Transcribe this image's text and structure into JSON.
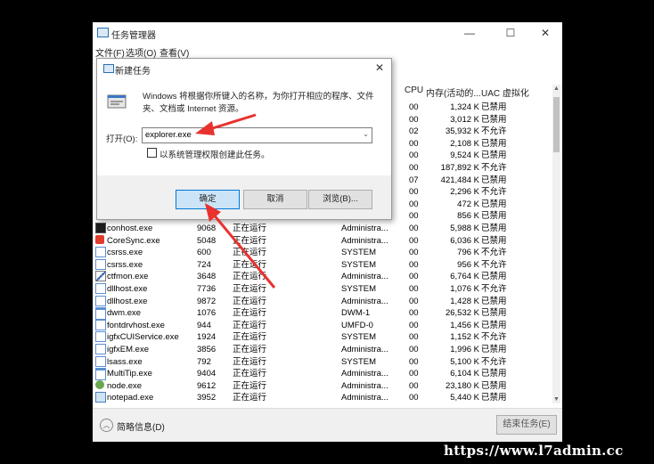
{
  "window": {
    "title": "任务管理器",
    "controls": {
      "minimize": "—",
      "maximize": "☐",
      "close": "✕"
    }
  },
  "menu": [
    "文件(F)",
    "选项(O)",
    "查看(V)"
  ],
  "columns": {
    "cpu": "CPU",
    "memory": "内存(活动的...",
    "uac": "UAC 虚拟化"
  },
  "processes": [
    {
      "name": "",
      "pid": "",
      "status": "",
      "user": "",
      "cpu": "00",
      "memory": "1,324 K",
      "uac": "已禁用",
      "icon": "blank-icon"
    },
    {
      "name": "",
      "pid": "",
      "status": "",
      "user": "",
      "cpu": "00",
      "memory": "3,012 K",
      "uac": "已禁用",
      "icon": "blank-icon"
    },
    {
      "name": "",
      "pid": "",
      "status": "",
      "user": "",
      "cpu": "02",
      "memory": "35,932 K",
      "uac": "不允许",
      "icon": "blank-icon"
    },
    {
      "name": "",
      "pid": "",
      "status": "",
      "user": "",
      "cpu": "00",
      "memory": "2,108 K",
      "uac": "已禁用",
      "icon": "blank-icon"
    },
    {
      "name": "",
      "pid": "",
      "status": "",
      "user": "",
      "cpu": "00",
      "memory": "9,524 K",
      "uac": "已禁用",
      "icon": "blank-icon"
    },
    {
      "name": "",
      "pid": "",
      "status": "",
      "user": "",
      "cpu": "00",
      "memory": "187,892 K",
      "uac": "不允许",
      "icon": "blank-icon"
    },
    {
      "name": "",
      "pid": "",
      "status": "",
      "user": "",
      "cpu": "07",
      "memory": "421,484 K",
      "uac": "已禁用",
      "icon": "blank-icon"
    },
    {
      "name": "",
      "pid": "",
      "status": "",
      "user": "",
      "cpu": "00",
      "memory": "2,296 K",
      "uac": "不允许",
      "icon": "blank-icon"
    },
    {
      "name": "",
      "pid": "",
      "status": "",
      "user": "",
      "cpu": "00",
      "memory": "472 K",
      "uac": "已禁用",
      "icon": "blank-icon"
    },
    {
      "name": "",
      "pid": "",
      "status": "",
      "user": "",
      "cpu": "00",
      "memory": "856 K",
      "uac": "已禁用",
      "icon": "blank-icon"
    },
    {
      "name": "conhost.exe",
      "pid": "9068",
      "status": "正在运行",
      "user": "Administra...",
      "cpu": "00",
      "memory": "5,988 K",
      "uac": "已禁用",
      "icon": "console-icon"
    },
    {
      "name": "CoreSync.exe",
      "pid": "5048",
      "status": "正在运行",
      "user": "Administra...",
      "cpu": "00",
      "memory": "6,036 K",
      "uac": "已禁用",
      "icon": "adobe-icon"
    },
    {
      "name": "csrss.exe",
      "pid": "600",
      "status": "正在运行",
      "user": "SYSTEM",
      "cpu": "00",
      "memory": "796 K",
      "uac": "不允许",
      "icon": "system-icon"
    },
    {
      "name": "csrss.exe",
      "pid": "724",
      "status": "正在运行",
      "user": "SYSTEM",
      "cpu": "00",
      "memory": "956 K",
      "uac": "不允许",
      "icon": "system-icon"
    },
    {
      "name": "ctfmon.exe",
      "pid": "3648",
      "status": "正在运行",
      "user": "Administra...",
      "cpu": "00",
      "memory": "6,764 K",
      "uac": "已禁用",
      "icon": "pen-icon"
    },
    {
      "name": "dllhost.exe",
      "pid": "7736",
      "status": "正在运行",
      "user": "SYSTEM",
      "cpu": "00",
      "memory": "1,076 K",
      "uac": "不允许",
      "icon": "system-icon"
    },
    {
      "name": "dllhost.exe",
      "pid": "9872",
      "status": "正在运行",
      "user": "Administra...",
      "cpu": "00",
      "memory": "1,428 K",
      "uac": "已禁用",
      "icon": "system-icon"
    },
    {
      "name": "dwm.exe",
      "pid": "1076",
      "status": "正在运行",
      "user": "DWM-1",
      "cpu": "00",
      "memory": "26,532 K",
      "uac": "已禁用",
      "icon": "window-icon"
    },
    {
      "name": "fontdrvhost.exe",
      "pid": "944",
      "status": "正在运行",
      "user": "UMFD-0",
      "cpu": "00",
      "memory": "1,456 K",
      "uac": "已禁用",
      "icon": "system-icon"
    },
    {
      "name": "igfxCUIService.exe",
      "pid": "1924",
      "status": "正在运行",
      "user": "SYSTEM",
      "cpu": "00",
      "memory": "1,152 K",
      "uac": "不允许",
      "icon": "system-icon"
    },
    {
      "name": "igfxEM.exe",
      "pid": "3856",
      "status": "正在运行",
      "user": "Administra...",
      "cpu": "00",
      "memory": "1,996 K",
      "uac": "已禁用",
      "icon": "system-icon"
    },
    {
      "name": "lsass.exe",
      "pid": "792",
      "status": "正在运行",
      "user": "SYSTEM",
      "cpu": "00",
      "memory": "5,100 K",
      "uac": "不允许",
      "icon": "system-icon"
    },
    {
      "name": "MultiTip.exe",
      "pid": "9404",
      "status": "正在运行",
      "user": "Administra...",
      "cpu": "00",
      "memory": "6,104 K",
      "uac": "已禁用",
      "icon": "window-icon"
    },
    {
      "name": "node.exe",
      "pid": "9612",
      "status": "正在运行",
      "user": "Administra...",
      "cpu": "00",
      "memory": "23,180 K",
      "uac": "已禁用",
      "icon": "node-icon"
    },
    {
      "name": "notepad.exe",
      "pid": "3952",
      "status": "正在运行",
      "user": "Administra...",
      "cpu": "00",
      "memory": "5,440 K",
      "uac": "已禁用",
      "icon": "notepad-icon"
    }
  ],
  "footer": {
    "fewer_details": "简略信息(D)",
    "end_task": "结束任务(E)"
  },
  "run_dialog": {
    "title": "新建任务",
    "close": "✕",
    "description": "Windows 将根据你所键入的名称，为你打开相应的程序、文件夹、文档或 Internet 资源。",
    "open_label": "打开(O):",
    "open_value": "explorer.exe",
    "admin_checkbox_label": "以系统管理权限创建此任务。",
    "ok": "确定",
    "cancel": "取消",
    "browse": "浏览(B)..."
  },
  "colors": {
    "annotation_arrow": "#e8322e",
    "primary_button_border": "#0078d7",
    "primary_button_fill": "#cce4f7"
  },
  "watermark": "https://www.l7admin.cc"
}
